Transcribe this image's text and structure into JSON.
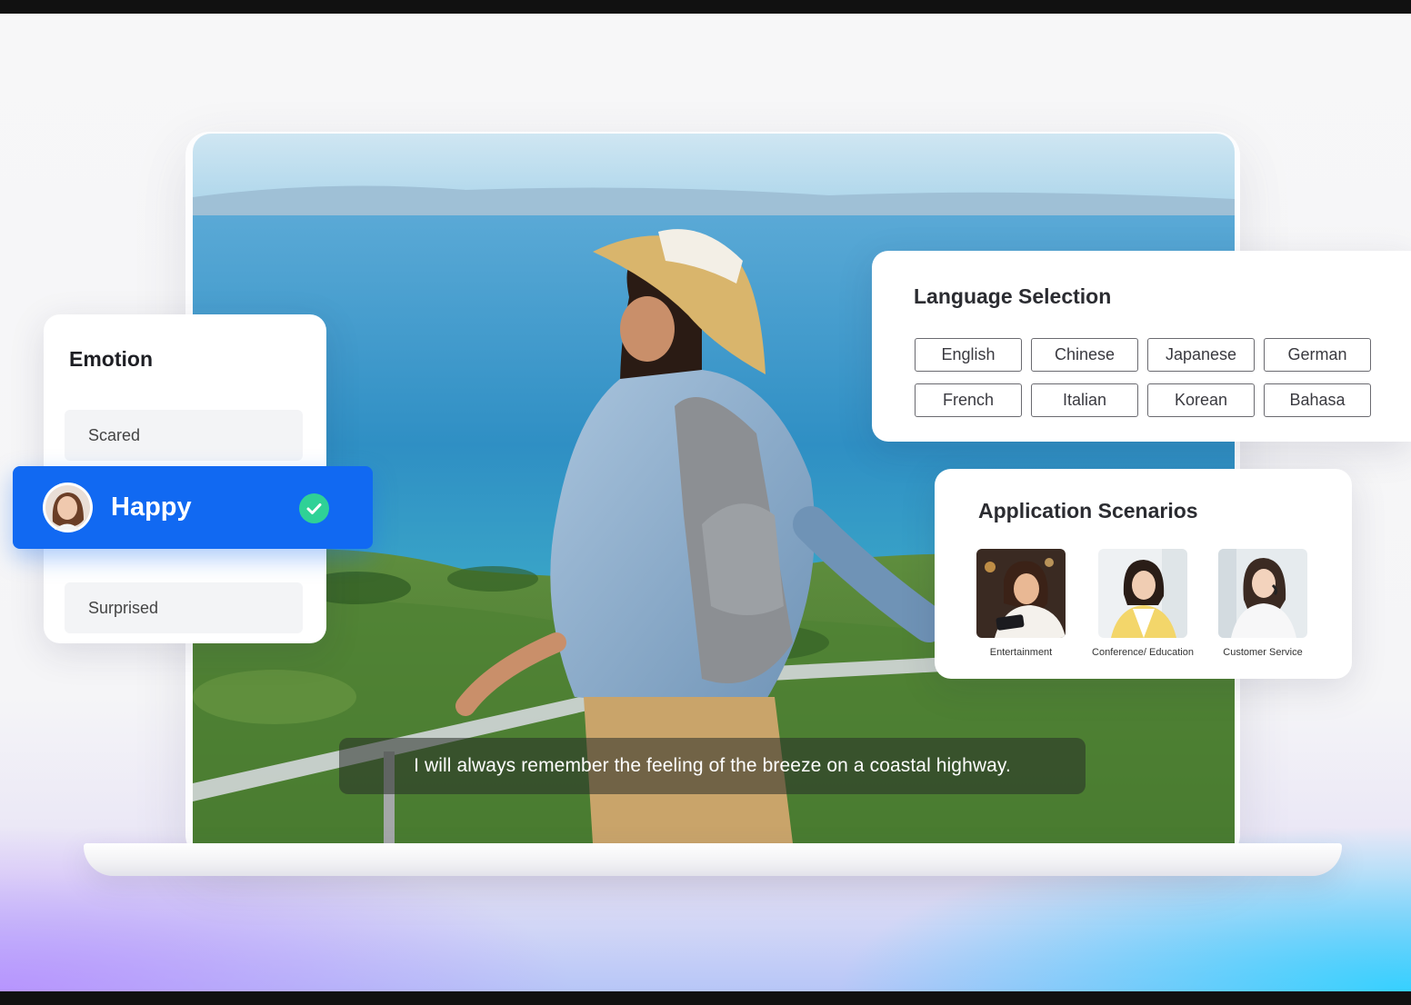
{
  "subtitle": "I will always remember the feeling of the breeze on a coastal highway.",
  "emotion": {
    "title": "Emotion",
    "options": [
      "Scared",
      "Happy",
      "Surprised"
    ],
    "selected": "Happy",
    "selected_color": "#1169f2"
  },
  "language": {
    "title": "Language Selection",
    "options": [
      "English",
      "Chinese",
      "Japanese",
      "German",
      "French",
      "Italian",
      "Korean",
      "Bahasa"
    ]
  },
  "scenarios": {
    "title": "Application Scenarios",
    "items": [
      {
        "label": "Entertainment",
        "icon": "woman-with-phone-thumbnail"
      },
      {
        "label": "Conference/ Education",
        "icon": "woman-at-desk-thumbnail"
      },
      {
        "label": "Customer Service",
        "icon": "woman-with-headset-thumbnail"
      }
    ]
  }
}
